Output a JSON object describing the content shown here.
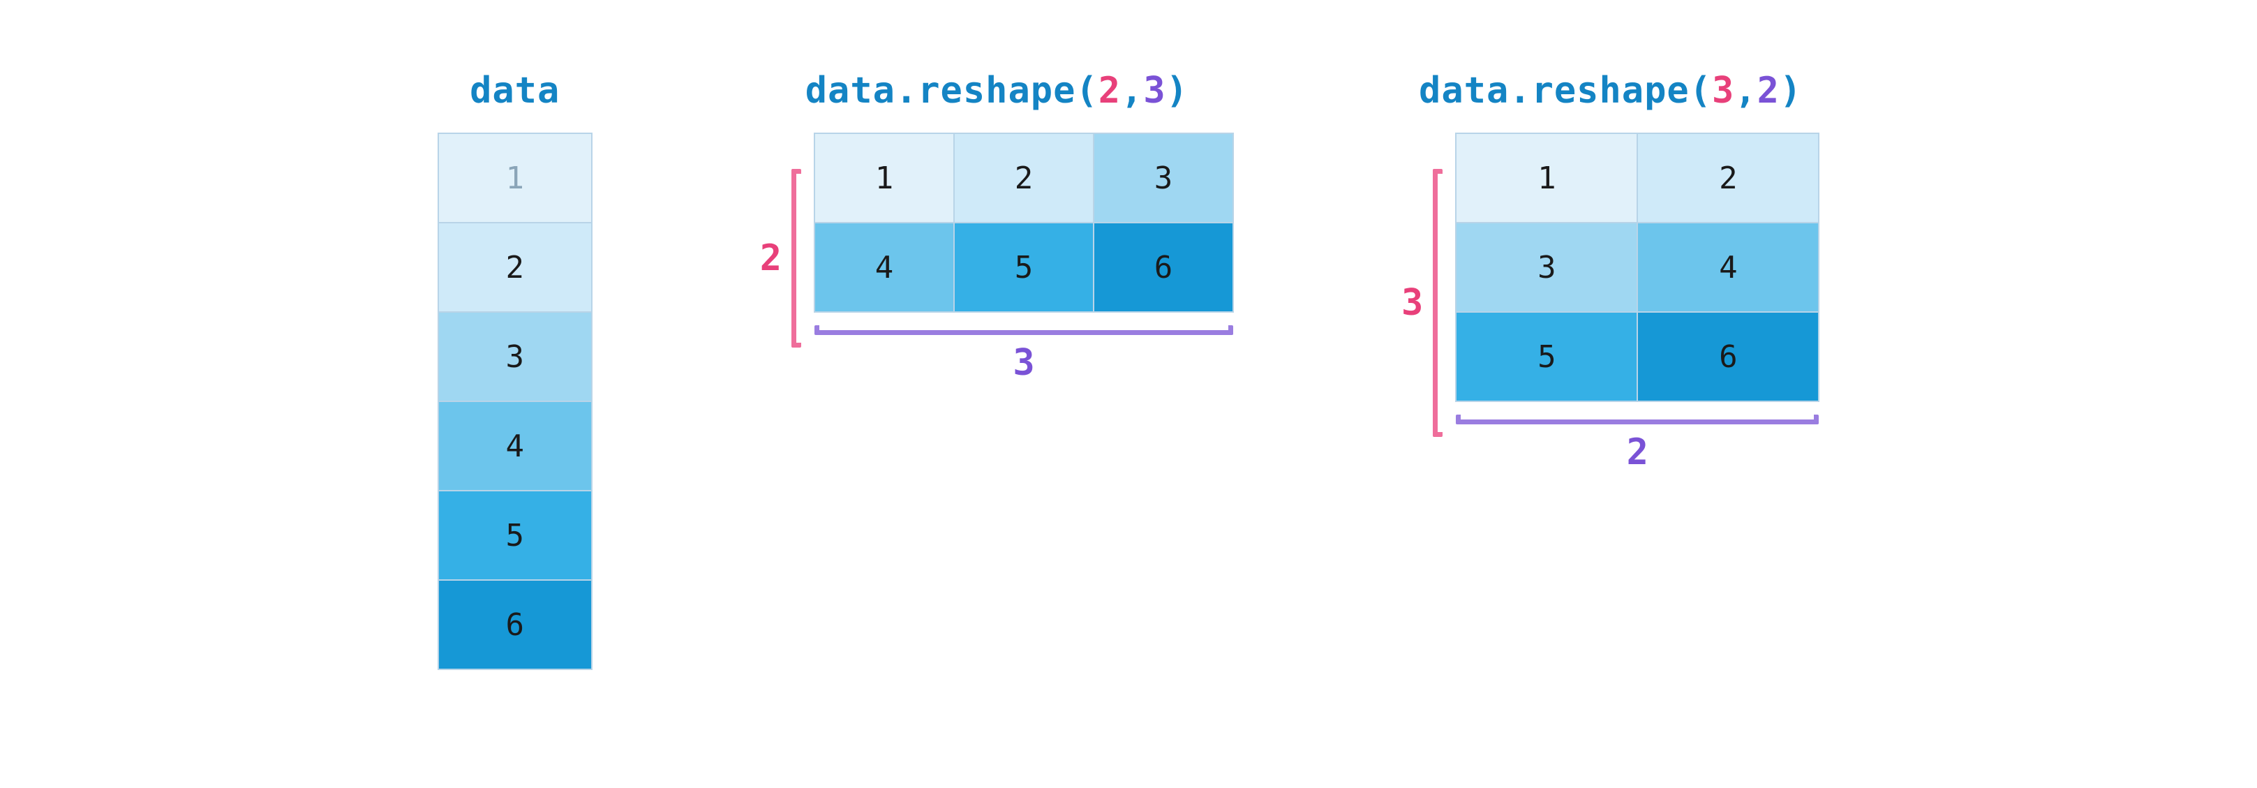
{
  "palette": {
    "pink": "#e8407a",
    "purple": "#7a52d6",
    "blue": "#1484c4",
    "shades": [
      "#e1f1fa",
      "#cfeaf9",
      "#9fd7f2",
      "#6cc5ec",
      "#35b0e6",
      "#1698d6"
    ]
  },
  "panels": {
    "vector": {
      "title": "data",
      "values": [
        1,
        2,
        3,
        4,
        5,
        6
      ]
    },
    "reshape23": {
      "title_parts": {
        "pre": "data.reshape(",
        "a": "2",
        "comma": ",",
        "b": "3",
        "post": ")"
      },
      "rows": 2,
      "cols": 3,
      "row_label": "2",
      "col_label": "3",
      "values": [
        [
          1,
          2,
          3
        ],
        [
          4,
          5,
          6
        ]
      ]
    },
    "reshape32": {
      "title_parts": {
        "pre": "data.reshape(",
        "a": "3",
        "comma": ",",
        "b": "2",
        "post": ")"
      },
      "rows": 3,
      "cols": 2,
      "row_label": "3",
      "col_label": "2",
      "values": [
        [
          1,
          2
        ],
        [
          3,
          4
        ],
        [
          5,
          6
        ]
      ]
    }
  }
}
